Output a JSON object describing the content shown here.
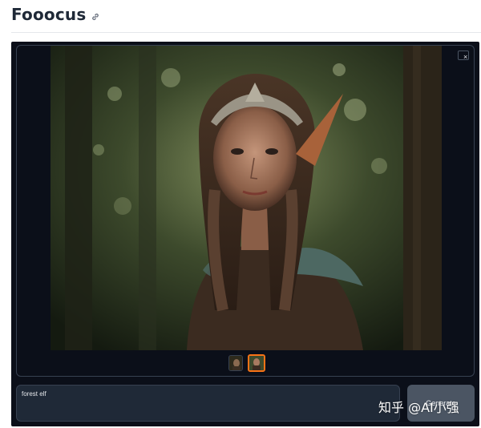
{
  "app": {
    "title": "Fooocus",
    "link_icon": "link-icon"
  },
  "gallery": {
    "close_label": "×",
    "image_alt": "Forest elf portrait",
    "thumbnails": [
      {
        "icon": "thumbnail-image",
        "selected": false
      },
      {
        "icon": "thumbnail-image",
        "selected": true
      }
    ]
  },
  "prompt": {
    "value": "forest elf"
  },
  "generate": {
    "label": "Generate"
  },
  "watermark": {
    "text": "知乎 @AI小强"
  },
  "colors": {
    "panel_bg": "#0b0f19",
    "accent_selected": "#f97316",
    "prompt_bg": "#1f2937",
    "button_bg": "#4b5563"
  }
}
